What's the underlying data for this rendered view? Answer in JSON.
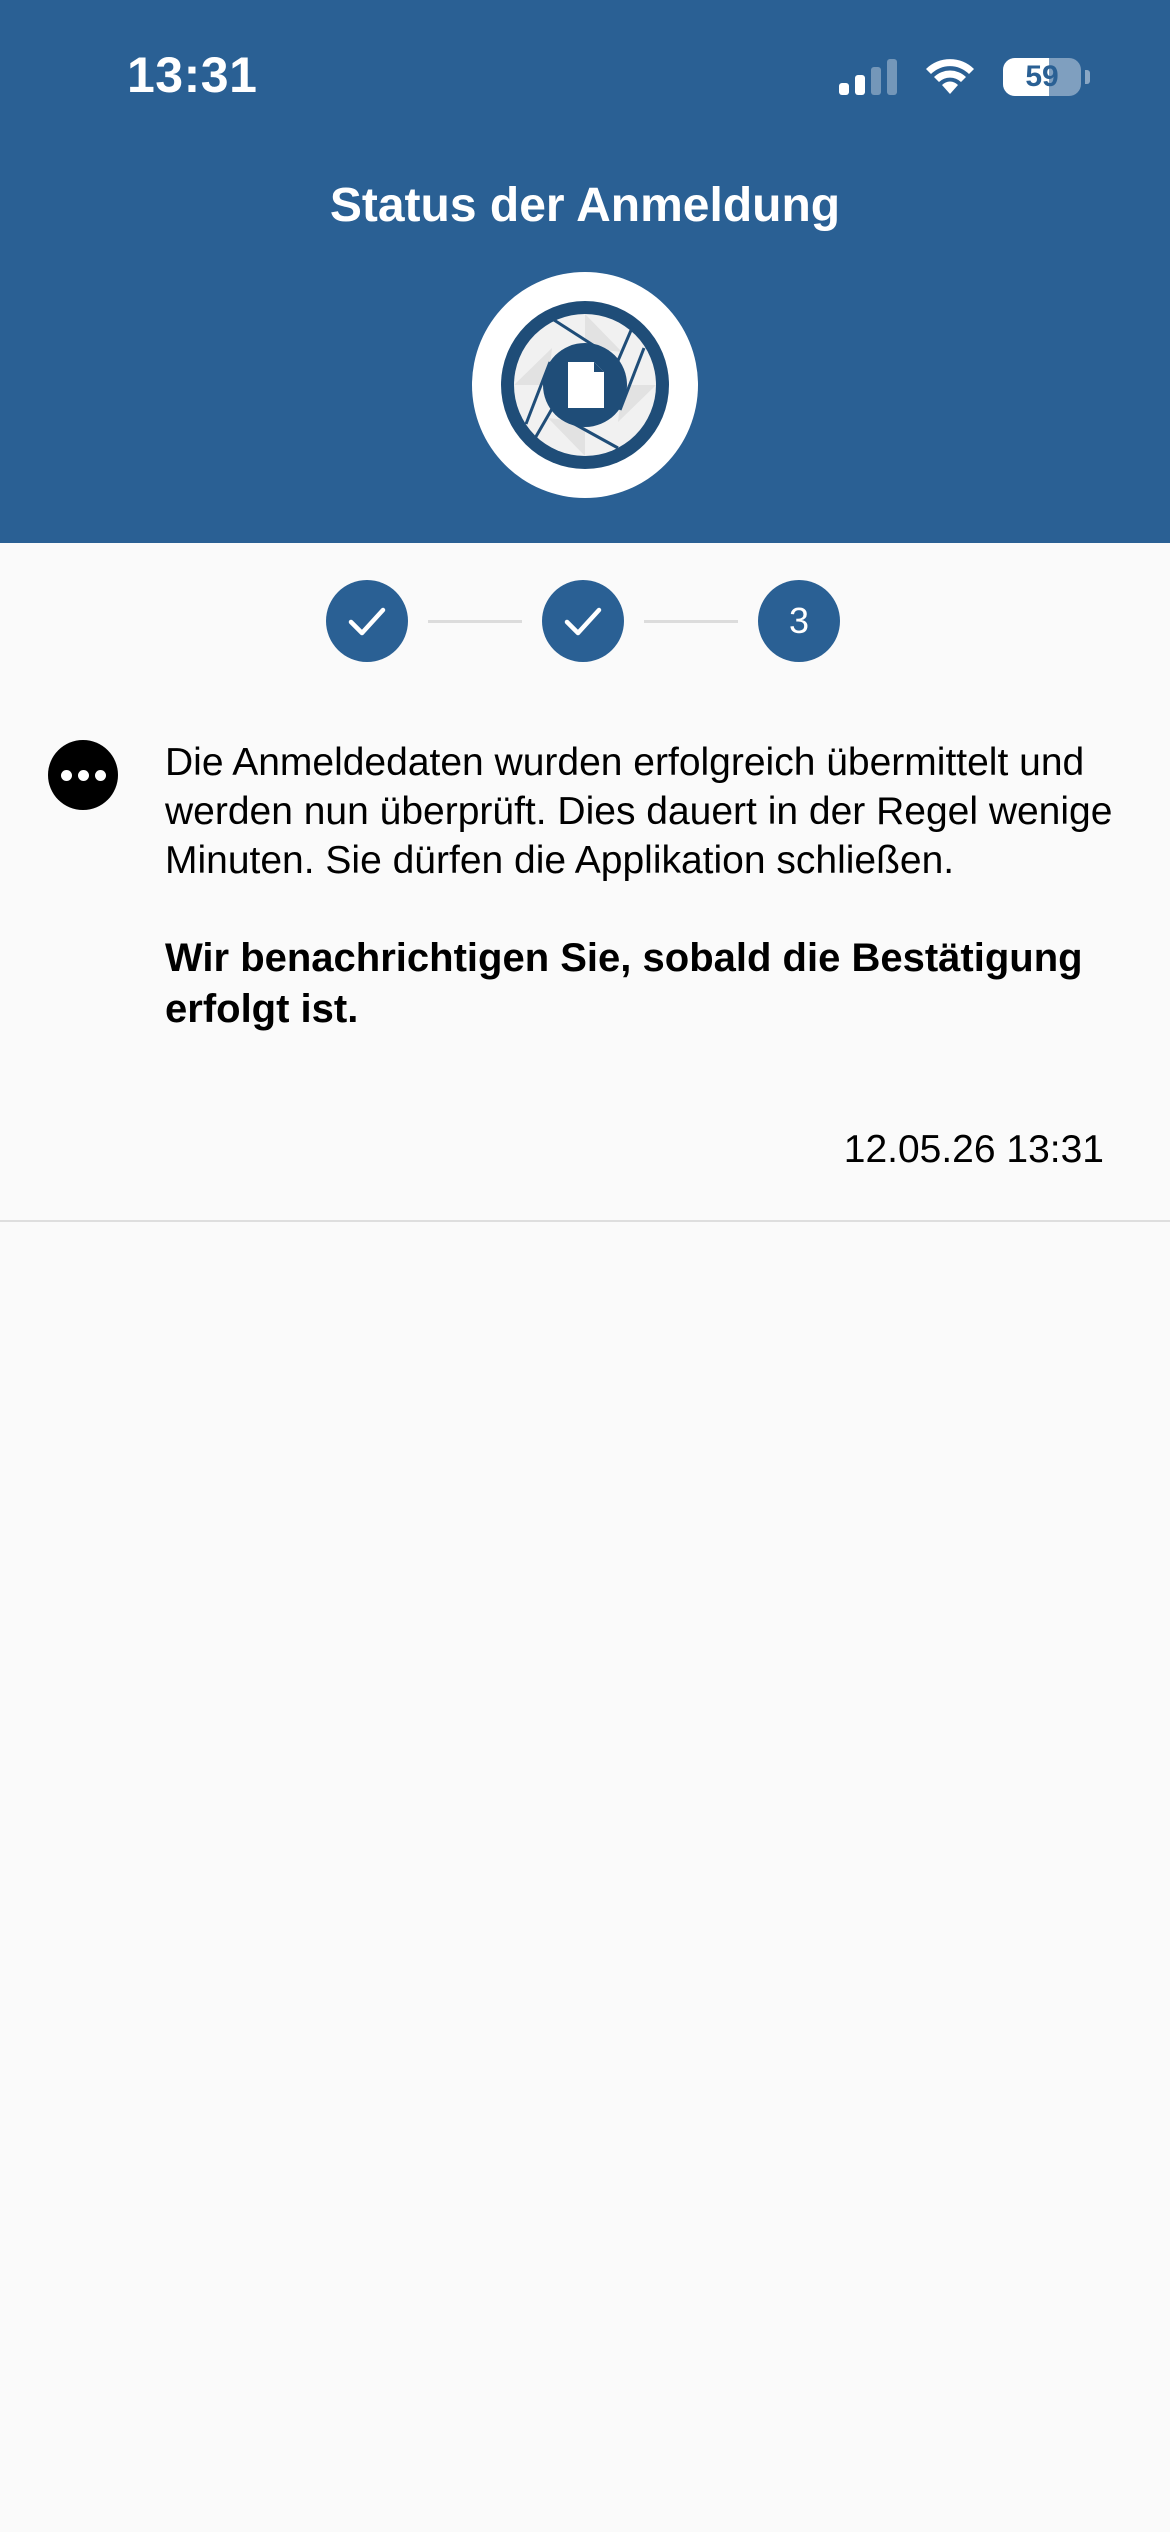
{
  "status_bar": {
    "time": "13:31",
    "battery": "59",
    "battery_level": 0.59,
    "icons": [
      "signal-icon",
      "wifi-icon",
      "battery-icon"
    ]
  },
  "header": {
    "title": "Status der Anmeldung",
    "logo_icon": "aperture-document-logo-icon"
  },
  "steps": [
    {
      "state": "done",
      "icon": "checkmark-icon"
    },
    {
      "state": "done",
      "icon": "checkmark-icon"
    },
    {
      "state": "current",
      "label": "3"
    }
  ],
  "message": {
    "icon": "more-dots-icon",
    "text": "Die Anmeldedaten wurden erfolgreich übermittelt und werden nun überprüft. Dies dauert in der Regel wenige Minuten. Sie dürfen die Applikation schließen.",
    "bold_text": "Wir benachrichtigen Sie, sobald die Bestätigung erfolgt ist.",
    "timestamp": "12.05.26 13:31"
  },
  "colors": {
    "brand": "#2a6094",
    "background": "#fafafa",
    "divider": "#dedede"
  }
}
